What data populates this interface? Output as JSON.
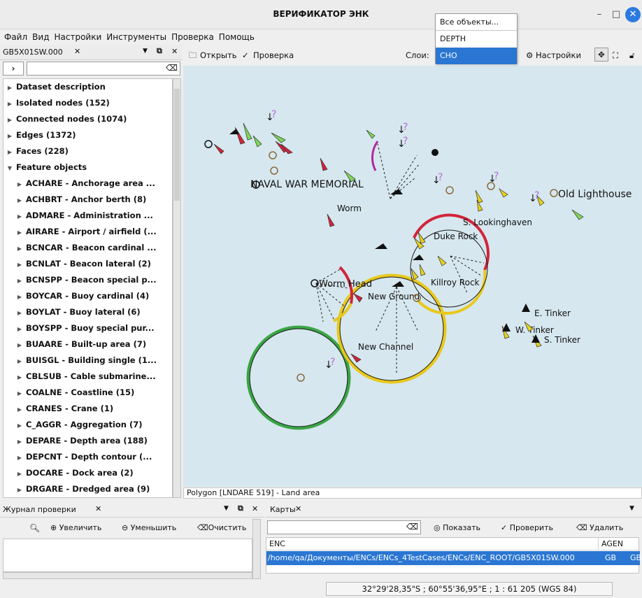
{
  "window": {
    "title": "ВЕРИФИКАТОР ЭНК"
  },
  "menu": [
    "Файл",
    "Вид",
    "Настройки",
    "Инструменты",
    "Проверка",
    "Помощь"
  ],
  "layers_dropdown": {
    "items": [
      "Все объекты...",
      "DEPTH",
      "CHO"
    ],
    "selected": "CHO"
  },
  "tree_panel": {
    "tab": "GB5X01SW.000",
    "items": [
      {
        "label": "Dataset description",
        "level": 0
      },
      {
        "label": "Isolated nodes (152)",
        "level": 0
      },
      {
        "label": "Connected nodes (1074)",
        "level": 0
      },
      {
        "label": "Edges (1372)",
        "level": 0
      },
      {
        "label": "Faces (228)",
        "level": 0
      },
      {
        "label": "Feature objects",
        "level": 0,
        "expanded": true
      },
      {
        "label": "ACHARE - Anchorage area ...",
        "level": 1
      },
      {
        "label": "ACHBRT - Anchor berth (8)",
        "level": 1
      },
      {
        "label": "ADMARE - Administration ...",
        "level": 1
      },
      {
        "label": "AIRARE - Airport / airfield (...",
        "level": 1
      },
      {
        "label": "BCNCAR - Beacon cardinal ...",
        "level": 1
      },
      {
        "label": "BCNLAT - Beacon lateral (2)",
        "level": 1
      },
      {
        "label": "BCNSPP - Beacon special p...",
        "level": 1
      },
      {
        "label": "BOYCAR - Buoy cardinal (4)",
        "level": 1
      },
      {
        "label": "BOYLAT - Buoy lateral (6)",
        "level": 1
      },
      {
        "label": "BOYSPP - Buoy special pur...",
        "level": 1
      },
      {
        "label": "BUAARE - Built-up area (7)",
        "level": 1
      },
      {
        "label": "BUISGL - Building single (1...",
        "level": 1
      },
      {
        "label": "CBLSUB - Cable submarine...",
        "level": 1
      },
      {
        "label": "COALNE - Coastline (15)",
        "level": 1
      },
      {
        "label": "CRANES - Crane (1)",
        "level": 1
      },
      {
        "label": "C_AGGR - Aggregation (7)",
        "level": 1
      },
      {
        "label": "DEPARE - Depth area (188)",
        "level": 1
      },
      {
        "label": "DEPCNT - Depth contour (...",
        "level": 1
      },
      {
        "label": "DOCARE - Dock area (2)",
        "level": 1
      },
      {
        "label": "DRGARE - Dredged area (9)",
        "level": 1
      }
    ]
  },
  "toolbar": {
    "open": "Открыть",
    "check": "Проверка",
    "layers_label": "Слои:",
    "layers_value": "CHO",
    "settings": "Настройки"
  },
  "map": {
    "labels": [
      "NAVAL WAR MEMORIAL",
      "Worm",
      "S. Lookinghaven",
      "Duke Rock",
      "Old Lighthouse",
      "Worm Head",
      "Killroy Rock",
      "New Ground",
      "New Channel",
      "E. Tinker",
      "W. Tinker",
      "S. Tinker"
    ],
    "status": "Polygon [LNDARE 519] - Land area"
  },
  "log_panel": {
    "tab": "Журнал проверки",
    "zoom_in": "Увеличить",
    "zoom_out": "Уменьшить",
    "clear": "Очистить"
  },
  "charts_panel": {
    "tab": "Карты",
    "show": "Показать",
    "verify": "Проверить",
    "delete": "Удалить",
    "columns": [
      "ENC",
      "AGEN"
    ],
    "rows": [
      {
        "enc": "/home/qa/Документы/ENCs/ENCs_4TestCases/ENCs/ENC_ROOT/GB5X01SW.000",
        "agen": "GB",
        "extra": "GB"
      }
    ]
  },
  "statusbar": {
    "coords": "32°29'28,35\"S ; 60°55'36,95\"E ; 1 : 61 205 (WGS 84)"
  },
  "colors": {
    "selection": "#2a76d2",
    "sea": "#d6e7ef",
    "ring_red": "#d2243a",
    "ring_yellow": "#e8c81c",
    "ring_green": "#3aa545"
  }
}
